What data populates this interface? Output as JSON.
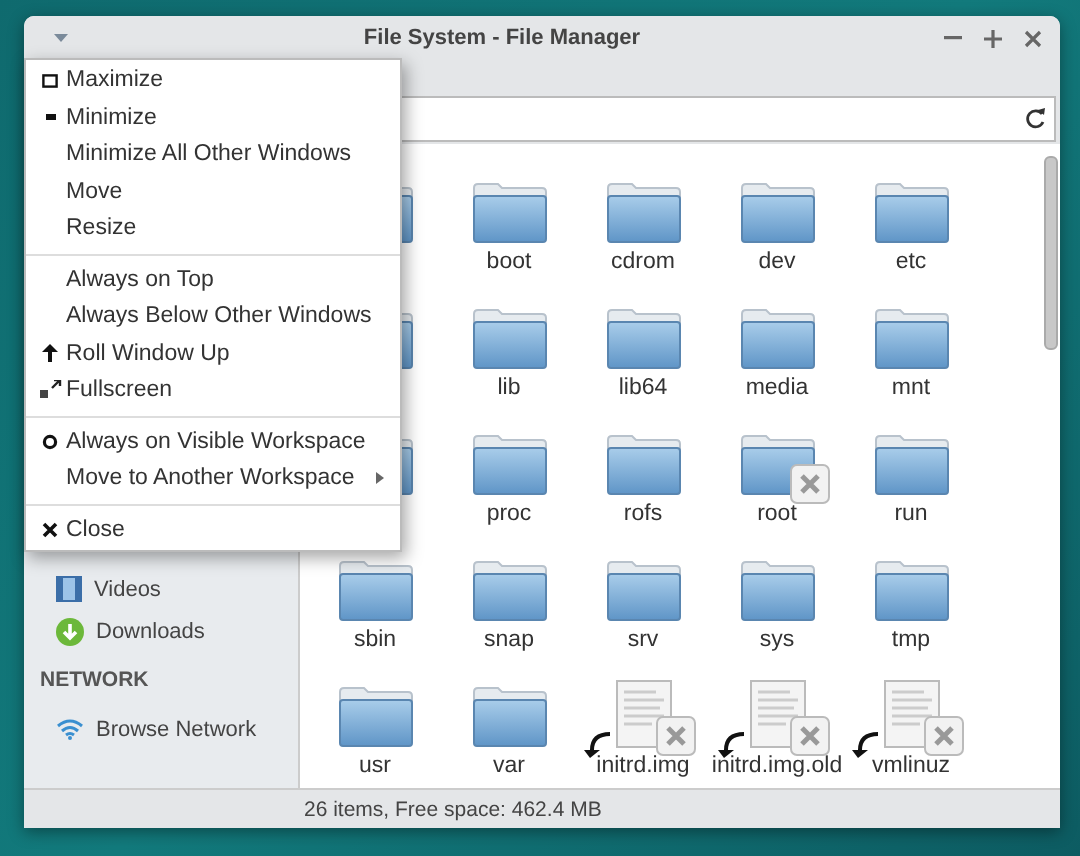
{
  "window": {
    "title": "File System - File Manager"
  },
  "window_menu": {
    "sections": [
      [
        {
          "label": "Maximize",
          "kind": "maximize",
          "checked": false,
          "submenu": false
        },
        {
          "label": "Minimize",
          "kind": "minimize",
          "checked": false,
          "submenu": false
        },
        {
          "label": "Minimize All Other Windows",
          "kind": "plain",
          "checked": false,
          "submenu": false
        },
        {
          "label": "Move",
          "kind": "plain",
          "checked": false,
          "submenu": false
        },
        {
          "label": "Resize",
          "kind": "plain",
          "checked": false,
          "submenu": false
        }
      ],
      [
        {
          "label": "Always on Top",
          "kind": "plain",
          "checked": false,
          "submenu": false
        },
        {
          "label": "Always Below Other Windows",
          "kind": "plain",
          "checked": false,
          "submenu": false
        },
        {
          "label": "Roll Window Up",
          "kind": "roll-up",
          "checked": false,
          "submenu": false
        },
        {
          "label": "Fullscreen",
          "kind": "fullscreen",
          "checked": false,
          "submenu": false
        }
      ],
      [
        {
          "label": "Always on Visible Workspace",
          "kind": "plain",
          "checked": true,
          "submenu": false
        },
        {
          "label": "Move to Another Workspace",
          "kind": "plain",
          "checked": false,
          "submenu": true
        }
      ],
      [
        {
          "label": "Close",
          "kind": "close",
          "checked": false,
          "submenu": false
        }
      ]
    ]
  },
  "sidebar": {
    "items": [
      {
        "kind": "videos",
        "label": "Videos"
      },
      {
        "kind": "downloads",
        "label": "Downloads"
      },
      {
        "kind": "header",
        "label": "NETWORK"
      },
      {
        "kind": "network",
        "label": "Browse Network"
      }
    ]
  },
  "files": [
    {
      "kind": "folder"
    },
    {
      "kind": "folder",
      "name": "boot"
    },
    {
      "kind": "folder",
      "name": "cdrom"
    },
    {
      "kind": "folder",
      "name": "dev"
    },
    {
      "kind": "folder",
      "name": "etc"
    },
    {
      "kind": "folder"
    },
    {
      "kind": "folder",
      "name": "lib"
    },
    {
      "kind": "folder",
      "name": "lib64"
    },
    {
      "kind": "folder",
      "name": "media"
    },
    {
      "kind": "folder",
      "name": "mnt"
    },
    {
      "kind": "folder"
    },
    {
      "kind": "folder",
      "name": "proc"
    },
    {
      "kind": "folder",
      "name": "rofs"
    },
    {
      "kind": "locked-folder",
      "name": "root"
    },
    {
      "kind": "folder",
      "name": "run"
    },
    {
      "kind": "folder",
      "name": "sbin"
    },
    {
      "kind": "folder",
      "name": "snap"
    },
    {
      "kind": "folder",
      "name": "srv"
    },
    {
      "kind": "folder",
      "name": "sys"
    },
    {
      "kind": "folder",
      "name": "tmp"
    },
    {
      "kind": "folder",
      "name": "usr"
    },
    {
      "kind": "folder",
      "name": "var"
    },
    {
      "kind": "broken-link",
      "name": "initrd.img"
    },
    {
      "kind": "broken-link",
      "name": "initrd.img.old"
    },
    {
      "kind": "broken-link",
      "name": "vmlinuz"
    }
  ],
  "status_bar": "26 items, Free space: 462.4 MB"
}
